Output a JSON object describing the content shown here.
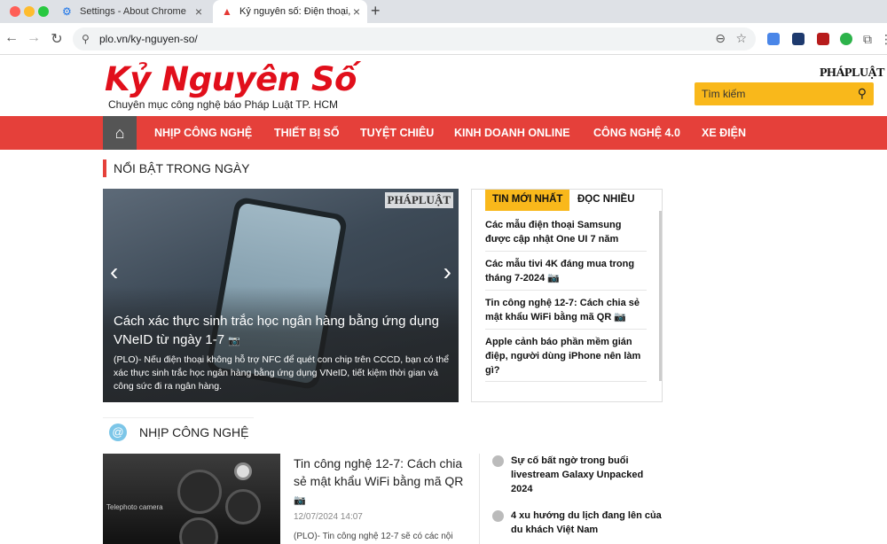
{
  "browser": {
    "tabs": [
      {
        "title": "Settings - About Chrome",
        "active": false
      },
      {
        "title": "Kỷ nguyên số: Điện thoại, Lap",
        "active": true
      }
    ],
    "url": "plo.vn/ky-nguyen-so/",
    "colors": {
      "close": "#ff5f57",
      "minimize": "#febc2e",
      "maximize": "#28c840"
    }
  },
  "site": {
    "logo_title": "Kỷ Nguyên Số",
    "logo_subtitle": "Chuyên mục công nghệ báo Pháp Luật TP. HCM",
    "brand_mark": "PHÁPLUẬT",
    "search_placeholder": "Tìm kiếm",
    "accent": "#e5403a",
    "yellow": "#f9b81b"
  },
  "nav": {
    "items": [
      "NHỊP CÔNG NGHỆ",
      "THIẾT BỊ SỐ",
      "TUYỆT CHIÊU",
      "KINH DOANH ONLINE",
      "CÔNG NGHỆ 4.0",
      "XE ĐIỆN"
    ]
  },
  "featured": {
    "section_title": "NỔI BẬT TRONG NGÀY",
    "hero_title": "Cách xác thực sinh trắc học ngân hàng bằng ứng dụng VNeID từ ngày 1-7",
    "hero_desc": "(PLO)- Nếu điện thoại không hỗ trợ NFC để quét con chip trên CCCD, bạn có thể xác thực sinh trắc học ngân hàng bằng ứng dụng VNeID, tiết kiệm thời gian và công sức đi ra ngân hàng.",
    "watermark": "PHÁPLUẬT"
  },
  "latest": {
    "tab_latest": "TIN MỚI NHẤT",
    "tab_popular": "ĐỌC NHIỀU",
    "items": [
      "Các mẫu điện thoại Samsung được cập nhật One UI 7 năm",
      "Các mẫu tivi 4K đáng mua trong tháng 7-2024",
      "Tin công nghệ 12-7: Cách chia sẻ mật khẩu WiFi bằng mã QR",
      "Apple cảnh báo phần mềm gián điệp, người dùng iPhone nên làm gì?"
    ]
  },
  "tech_section": {
    "title": "NHỊP CÔNG NGHỆ",
    "article_title": "Tin công nghệ 12-7: Cách chia sẻ mật khẩu WiFi bằng mã QR",
    "article_date": "12/07/2024 14:07",
    "article_desc": "(PLO)- Tin công nghệ 12-7 sẽ có các nội",
    "thumb_caption": "Telephoto camera",
    "side_items": [
      "Sự cố bất ngờ trong buổi livestream Galaxy Unpacked 2024",
      "4 xu hướng du lịch đang lên của du khách Việt Nam"
    ]
  }
}
